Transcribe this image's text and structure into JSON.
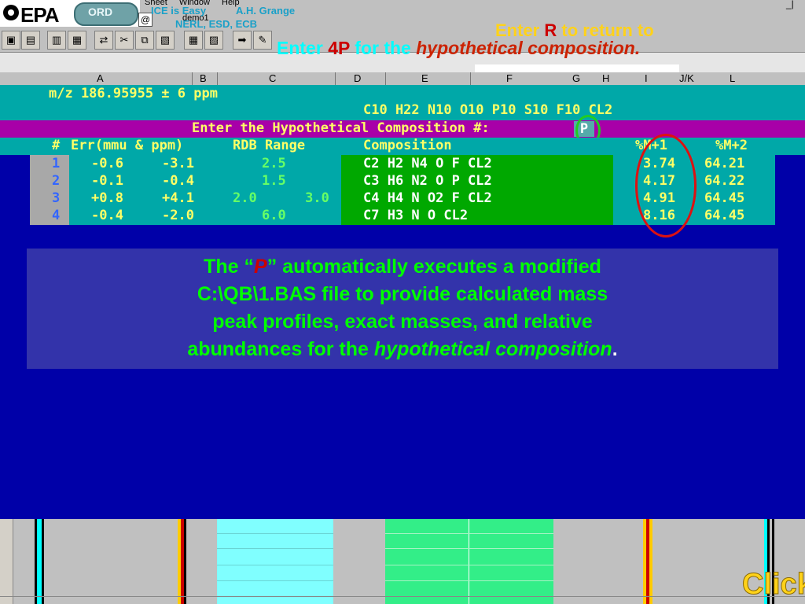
{
  "header": {
    "menu": [
      "Sheet",
      "Window",
      "Help"
    ],
    "window_title": "demo1",
    "overlay_title": "ICE is Easy",
    "overlay_author": "A.H. Grange",
    "overlay_org": "NERL, ESD, ECB",
    "epa_logo": "EPA",
    "ord_logo": "ORD"
  },
  "toolbar_icons": [
    "new-file-icon",
    "open-file-icon",
    "save-icon",
    "print-icon",
    "print-preview-icon",
    "undo-icon",
    "cut-icon",
    "copy-icon",
    "paste-icon",
    "chart-icon",
    "grid-icon",
    "image-icon",
    "arrow-icon",
    "brush-icon"
  ],
  "instruction": {
    "prefix": "Enter ",
    "key": "4P",
    "middle": " for the ",
    "emphasis": "hypothetical composition."
  },
  "return_hint": {
    "prefix": "Enter ",
    "key": "R",
    "suffix": " to return to"
  },
  "columns": [
    "A",
    "B",
    "C",
    "D",
    "E",
    "F",
    "G",
    "H",
    "I",
    "J/K",
    "L"
  ],
  "terminal": {
    "mz_line": "m/z 186.95955 ± 6 ppm",
    "max_formula": "C10 H22 N10 O10 P10 S10 F10 CL2",
    "prompt": "Enter the Hypothetical Composition #:",
    "input_value": "P",
    "headers": [
      "#",
      "Err(mmu & ppm)",
      "RDB Range",
      "Composition",
      "%M+1",
      "%M+2"
    ],
    "rows": [
      {
        "n": "1",
        "mmu": "-0.6",
        "ppm": "-3.1",
        "rdb": "2.5",
        "comp": "C2 H2 N4 O F CL2",
        "m1": "3.74",
        "m2": "64.21"
      },
      {
        "n": "2",
        "mmu": "-0.1",
        "ppm": "-0.4",
        "rdb": "1.5",
        "comp": "C3 H6 N2 O P CL2",
        "m1": "4.17",
        "m2": "64.22"
      },
      {
        "n": "3",
        "mmu": "+0.8",
        "ppm": "+4.1",
        "rdb": "2.0      3.0",
        "comp": "C4 H4 N O2 F CL2",
        "m1": "4.91",
        "m2": "64.45"
      },
      {
        "n": "4",
        "mmu": "-0.4",
        "ppm": "-2.0",
        "rdb": "6.0",
        "comp": "C7 H3 N O CL2",
        "m1": "8.16",
        "m2": "64.45"
      }
    ]
  },
  "explanation": {
    "line1_pre": "The “",
    "line1_key": "P",
    "line1_post": "” automatically executes a modified",
    "line2": "C:\\QB\\1.BAS file to provide calculated mass",
    "line3": "peak profiles, exact masses, and relative",
    "line4_pre": "abundances for the ",
    "line4_emph": "hypothetical composition",
    "line4_end": "."
  },
  "click_label": "Click",
  "colors": {
    "terminal_bg": "#0000a8",
    "teal": "#00a8a8",
    "prompt_bar": "#a800a8",
    "terminal_text": "#ffff66",
    "composition_bg": "#00a800",
    "highlight_green": "#00ff00",
    "accent_red": "#cc0000"
  }
}
